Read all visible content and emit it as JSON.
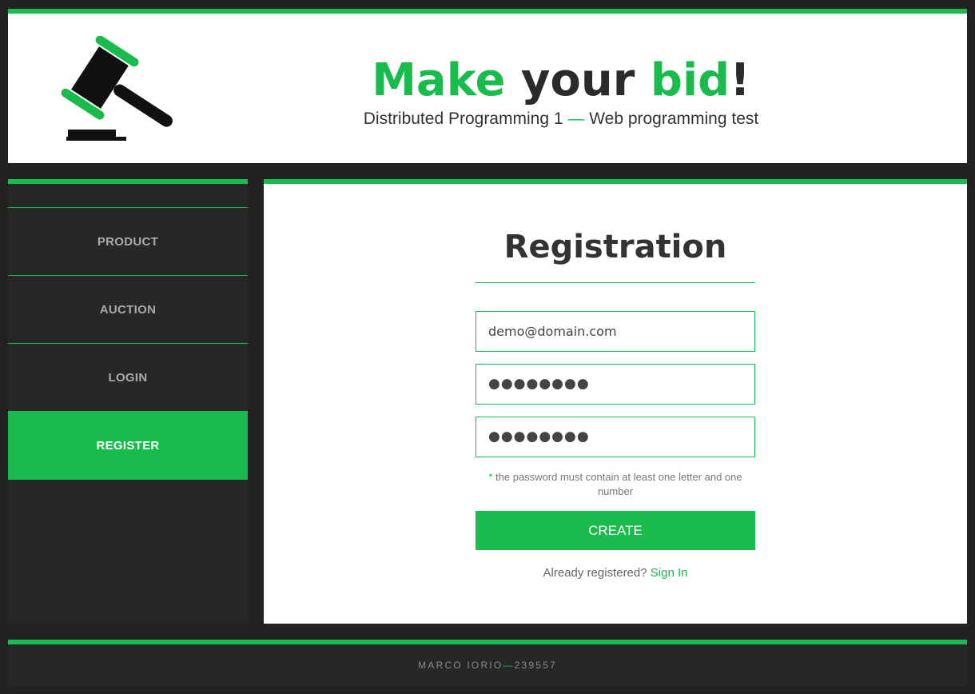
{
  "header": {
    "title_part1": "Make",
    "title_part2": " your ",
    "title_part3": "bid",
    "title_part4": "!",
    "subtitle_part1": "Distributed Programming 1 ",
    "subtitle_dash": "—",
    "subtitle_part2": " Web programming test",
    "logo_icon": "gavel-icon"
  },
  "sidebar": {
    "items": [
      {
        "label": "PRODUCT"
      },
      {
        "label": "AUCTION"
      },
      {
        "label": "LOGIN"
      },
      {
        "label": "REGISTER",
        "active": true
      }
    ]
  },
  "form": {
    "title": "Registration",
    "email_value": "demo@domain.com",
    "password_value": "●●●●●●●●",
    "confirm_value": "●●●●●●●●",
    "hint_star": "*",
    "hint_text": " the password must contain at least one letter and one number",
    "create_label": "CREATE",
    "already_text": "Already registered? ",
    "signin_label": "Sign In"
  },
  "footer": {
    "name": "MARCO IORIO ",
    "dash": "—",
    "id": " 239557"
  },
  "colors": {
    "accent": "#18bb4c",
    "background": "#222222",
    "panel": "#272727"
  }
}
